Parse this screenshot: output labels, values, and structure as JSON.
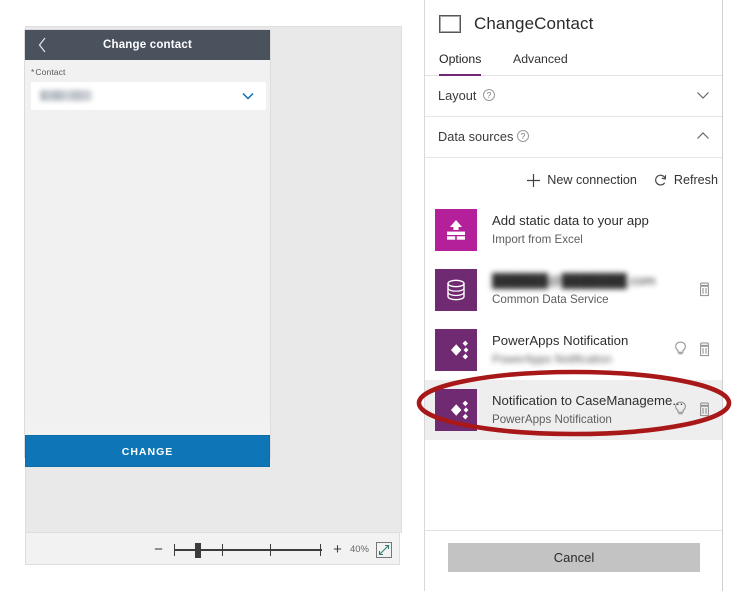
{
  "canvas": {
    "phone": {
      "header": {
        "back_icon": "chevron-left-icon",
        "title": "Change contact"
      },
      "form": {
        "field_label": "Contact",
        "required_marker": "*",
        "dropdown_value": "",
        "dropdown_icon": "chevron-down-icon"
      },
      "submit_label": "CHANGE"
    },
    "zoom_bar": {
      "minus_label": "−",
      "plus_label": "+",
      "zoom_level": "40%",
      "fit_icon": "fit-to-screen-icon"
    }
  },
  "right_panel": {
    "header": {
      "icon": "screen-icon",
      "title": "ChangeContact"
    },
    "tabs": [
      {
        "label": "Options",
        "active": true
      },
      {
        "label": "Advanced",
        "active": false
      }
    ],
    "sections": [
      {
        "label": "Layout",
        "help_icon": "help-icon",
        "expanded": false,
        "chevron": "chevron-down-icon"
      },
      {
        "label": "Data sources",
        "help_icon": "help-icon",
        "expanded": true,
        "chevron": "chevron-up-icon"
      }
    ],
    "data_sources": {
      "actions": [
        {
          "label": "New connection",
          "icon": "plus-icon"
        },
        {
          "label": "Refresh",
          "icon": "refresh-icon"
        }
      ],
      "items": [
        {
          "name": "Add static data to your app",
          "sub": "Import from Excel",
          "icon": "import-data-icon",
          "tile_color": "#b4209a",
          "name_blurred": false,
          "sub_blurred": false,
          "has_hint": false,
          "has_delete": false,
          "selected": false
        },
        {
          "name": "██████@███████.com",
          "sub": "Common Data Service",
          "icon": "database-icon",
          "tile_color": "#6f2a72",
          "name_blurred": true,
          "sub_blurred": false,
          "has_hint": false,
          "has_delete": true,
          "selected": false
        },
        {
          "name": "PowerApps Notification",
          "sub": "PowerApps Notification",
          "icon": "powerapps-icon",
          "tile_color": "#6f2a72",
          "name_blurred": false,
          "sub_blurred": true,
          "has_hint": true,
          "has_delete": true,
          "selected": false
        },
        {
          "name": "Notification to CaseManageme...",
          "sub": "PowerApps Notification",
          "icon": "powerapps-icon",
          "tile_color": "#6f2a72",
          "name_blurred": false,
          "sub_blurred": false,
          "has_hint": true,
          "has_delete": true,
          "selected": true
        }
      ]
    },
    "cancel_label": "Cancel"
  },
  "annotation": {
    "shape": "ellipse-highlight",
    "color": "#a81818"
  },
  "colors": {
    "accent_purple": "#742774",
    "tile_magenta": "#b4209a",
    "tile_purple": "#6f2a72",
    "phone_header": "#4a525e",
    "submit_blue": "#0e76b6",
    "annotation_red": "#a81818"
  }
}
